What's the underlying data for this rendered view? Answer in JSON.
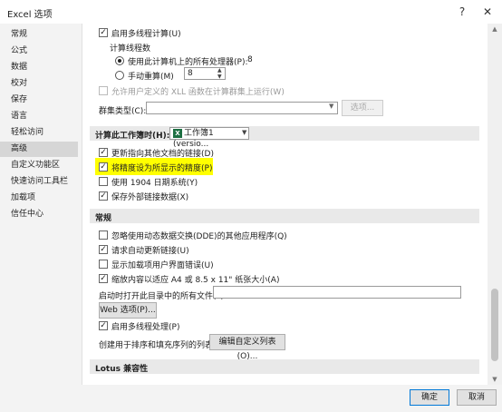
{
  "window": {
    "title": "Excel 选项",
    "help": "?",
    "close": "✕"
  },
  "sidebar": {
    "items": [
      "常规",
      "公式",
      "数据",
      "校对",
      "保存",
      "语言",
      "轻松访问",
      "高级",
      "自定义功能区",
      "快速访问工具栏",
      "加载项",
      "信任中心"
    ],
    "selected": "高级"
  },
  "formulas": {
    "multithread": "启用多线程计算(U)",
    "thread_count_label": "计算线程数",
    "use_all": "使用此计算机上的所有处理器(P):",
    "processor_count": "8",
    "manual": "手动重算(M)",
    "manual_value": "8",
    "xll": "允许用户定义的 XLL 函数在计算群集上运行(W)",
    "cluster_label": "群集类型(C):",
    "options_button": "选项..."
  },
  "workbook_calc": {
    "header": "计算此工作簿时(H):",
    "workbook": "工作簿1 (versio...",
    "update_links": "更新指向其他文档的链接(D)",
    "precision": "将精度设为所显示的精度(P)",
    "date1904": "使用 1904 日期系统(Y)",
    "save_external": "保存外部链接数据(X)"
  },
  "general": {
    "header": "常规",
    "ignore_dde": "忽略使用动态数据交换(DDE)的其他应用程序(Q)",
    "ask_update": "请求自动更新链接(U)",
    "show_addin_errors": "显示加载项用户界面错误(U)",
    "scale_content": "缩放内容以适应 A4 或 8.5 x 11\" 纸张大小(A)",
    "startup_label": "启动时打开此目录中的所有文件(L):",
    "web_options": "Web 选项(P)...",
    "multithread_processing": "启用多线程处理(P)",
    "custom_lists_label": "创建用于排序和填充序列的列表:",
    "edit_lists": "编辑自定义列表(O)..."
  },
  "lotus": {
    "header": "Lotus 兼容性"
  },
  "footer": {
    "ok": "确定",
    "cancel": "取消"
  }
}
